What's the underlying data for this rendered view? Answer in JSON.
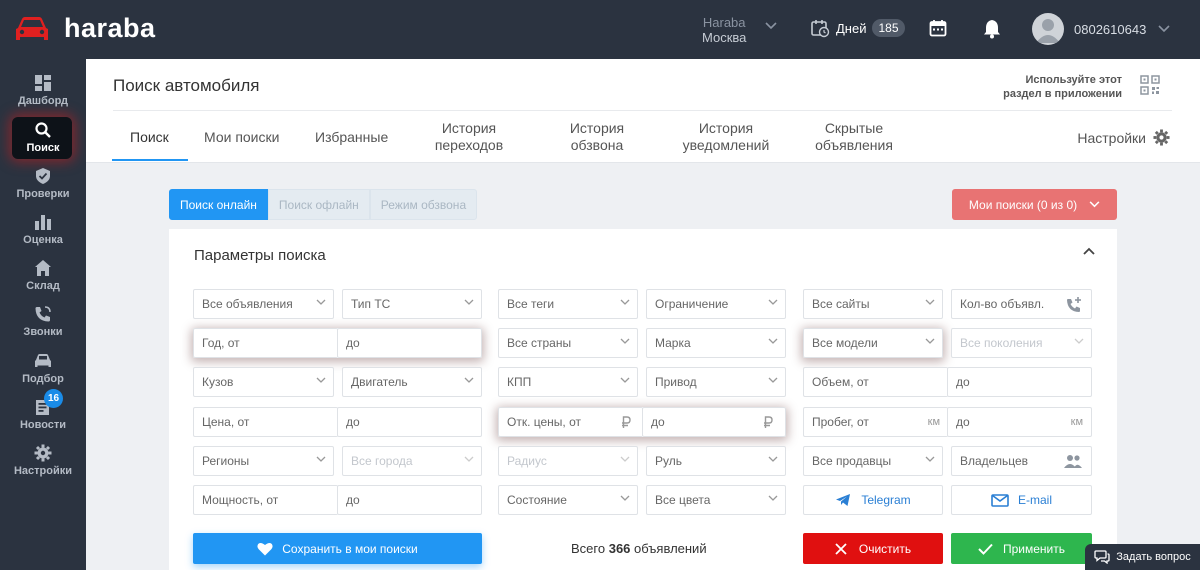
{
  "brand": {
    "name": "haraba",
    "accent": "#e02020"
  },
  "topbar": {
    "city_line1": "Haraba",
    "city_line2": "Москва",
    "days_label": "Дней",
    "days_count": "185",
    "phone": "0802610643"
  },
  "sidebar": {
    "items": [
      {
        "label": "Дашборд",
        "icon": "dashboard-icon"
      },
      {
        "label": "Поиск",
        "icon": "search-icon"
      },
      {
        "label": "Проверки",
        "icon": "shield-icon"
      },
      {
        "label": "Оценка",
        "icon": "bar-chart-icon"
      },
      {
        "label": "Склад",
        "icon": "home-icon"
      },
      {
        "label": "Звонки",
        "icon": "phone-icon"
      },
      {
        "label": "Подбор",
        "icon": "car-icon"
      },
      {
        "label": "Новости",
        "icon": "news-icon"
      },
      {
        "label": "Настройки",
        "icon": "gear-icon"
      }
    ],
    "news_badge": "16"
  },
  "header": {
    "title": "Поиск автомобиля",
    "app_hint_line1": "Используйте этот",
    "app_hint_line2": "раздел в приложении",
    "tabs": [
      {
        "line1": "Поиск",
        "line2": ""
      },
      {
        "line1": "Мои поиски",
        "line2": ""
      },
      {
        "line1": "Избранные",
        "line2": ""
      },
      {
        "line1": "История",
        "line2": "переходов"
      },
      {
        "line1": "История",
        "line2": "обзвона"
      },
      {
        "line1": "История",
        "line2": "уведомлений"
      },
      {
        "line1": "Скрытые",
        "line2": "объявления"
      }
    ],
    "settings_label": "Настройки"
  },
  "modes": {
    "online": "Поиск онлайн",
    "offline": "Поиск офлайн",
    "call": "Режим обзвона",
    "my_searches": "Мои поиски (0 из 0)"
  },
  "panel": {
    "title": "Параметры поиска",
    "fields": {
      "all_ads": "Все объявления",
      "vehicle_type": "Тип ТС",
      "all_tags": "Все теги",
      "restriction": "Ограничение",
      "all_sites": "Все сайты",
      "ads_count": "Кол-во объявл.",
      "year_from": "Год, от",
      "year_to": "до",
      "all_countries": "Все страны",
      "make": "Марка",
      "all_models": "Все модели",
      "all_generations": "Все поколения",
      "body": "Кузов",
      "engine": "Двигатель",
      "gearbox": "КПП",
      "drive": "Привод",
      "volume_from": "Объем, от",
      "volume_to": "до",
      "price_from": "Цена, от",
      "price_to": "до",
      "dev_price_from": "Отк. цены, от",
      "dev_price_to": "до",
      "mileage_from": "Пробег, от",
      "mileage_to": "до",
      "km_unit": "км",
      "regions": "Регионы",
      "all_cities": "Все города",
      "radius": "Радиус",
      "steering": "Руль",
      "all_sellers": "Все продавцы",
      "owners": "Владельцев",
      "power_from": "Мощность, от",
      "power_to": "до",
      "condition": "Состояние",
      "all_colors": "Все цвета",
      "telegram": "Telegram",
      "email": "E-mail"
    },
    "save_label": "Сохранить в мои поиски",
    "total_prefix": "Всего",
    "total_count": "366",
    "total_suffix": "объявлений",
    "clear_label": "Очистить",
    "apply_label": "Применить"
  },
  "ask_label": "Задать вопрос"
}
